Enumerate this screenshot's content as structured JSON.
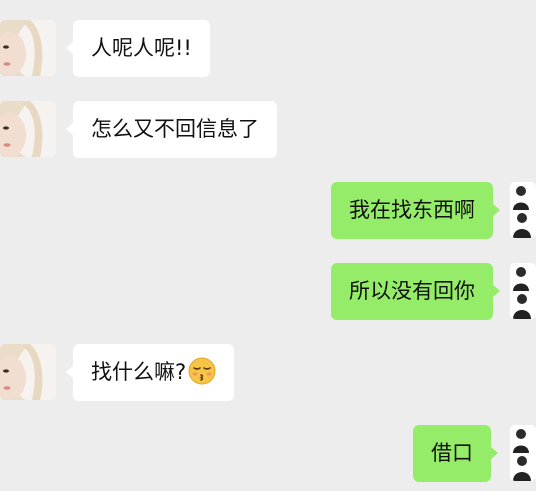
{
  "messages": [
    {
      "side": "left",
      "text": "人呢人呢!!"
    },
    {
      "side": "left",
      "text": "怎么又不回信息了"
    },
    {
      "side": "right",
      "text": "我在找东西啊"
    },
    {
      "side": "right",
      "text": "所以没有回你"
    },
    {
      "side": "left",
      "text": "找什么嘛?",
      "emoji": "kissing-closed-eyes-emoji"
    },
    {
      "side": "right",
      "text": "借口"
    }
  ],
  "colors": {
    "background": "#ededed",
    "incoming_bubble": "#ffffff",
    "outgoing_bubble": "#95ec69",
    "emoji_face": "#f7c545"
  }
}
